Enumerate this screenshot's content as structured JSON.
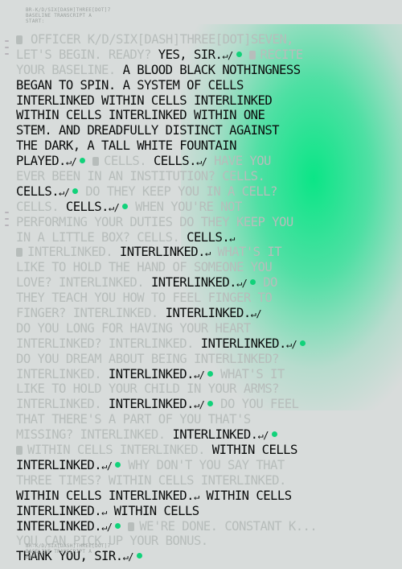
{
  "header_top": [
    "BR-K/D/SIX[DASH]THREE[DOT]7",
    "BASELINE TRANSCRIPT A",
    "START:"
  ],
  "header_bottom": [
    "BR-K/D/SIX[DASH]THREE[DOT]7",
    "BASELINE TRANSCRIPT A",
    "END:"
  ],
  "lines": [
    [
      [
        "sq",
        ""
      ],
      [
        "f",
        "OFFICER K/D/SIX[DASH]THREE[DOT]SEVEN,"
      ]
    ],
    [
      [
        "f",
        "LET'S BEGIN. READY? "
      ],
      [
        "d",
        "YES, SIR."
      ],
      [
        "m",
        "↵/"
      ],
      [
        "dot",
        ""
      ],
      [
        "f",
        " "
      ],
      [
        "sq",
        ""
      ],
      [
        "f",
        "RECITE"
      ]
    ],
    [
      [
        "f",
        "YOUR BASELINE. "
      ],
      [
        "d",
        "A BLOOD BLACK NOTHINGNESS"
      ]
    ],
    [
      [
        "d",
        "BEGAN TO SPIN. A SYSTEM OF CELLS"
      ]
    ],
    [
      [
        "d",
        "INTERLINKED WITHIN CELLS INTERLINKED"
      ]
    ],
    [
      [
        "d",
        "WITHIN CELLS INTERLINKED WITHIN ONE"
      ]
    ],
    [
      [
        "d",
        "STEM. AND DREADFULLY DISTINCT AGAINST"
      ]
    ],
    [
      [
        "d",
        "THE DARK, A TALL WHITE FOUNTAIN"
      ]
    ],
    [
      [
        "d",
        "PLAYED."
      ],
      [
        "m",
        "↵/"
      ],
      [
        "dot",
        ""
      ],
      [
        "f",
        " "
      ],
      [
        "sq",
        ""
      ],
      [
        "f",
        "CELLS. "
      ],
      [
        "d",
        "CELLS."
      ],
      [
        "m",
        "↵/"
      ],
      [
        "f",
        " HAVE YOU"
      ]
    ],
    [
      [
        "f",
        "EVER BEEN IN AN INSTITUTION? CELLS."
      ]
    ],
    [
      [
        "d",
        "CELLS."
      ],
      [
        "m",
        "↵/"
      ],
      [
        "dot",
        ""
      ],
      [
        "f",
        " DO THEY KEEP YOU IN A CELL?"
      ]
    ],
    [
      [
        "f",
        "CELLS. "
      ],
      [
        "d",
        "CELLS."
      ],
      [
        "m",
        "↵/"
      ],
      [
        "dot",
        ""
      ],
      [
        "f",
        " WHEN YOU'RE NOT"
      ]
    ],
    [
      [
        "f",
        "PERFORMING YOUR DUTIES DO THEY KEEP YOU"
      ]
    ],
    [
      [
        "f",
        "IN A LITTLE BOX? CELLS. "
      ],
      [
        "d",
        "CELLS."
      ],
      [
        "m",
        "↵"
      ]
    ],
    [
      [
        "sq",
        ""
      ],
      [
        "f",
        "INTERLINKED. "
      ],
      [
        "d",
        "INTERLINKED."
      ],
      [
        "m",
        "↵"
      ],
      [
        "f",
        "  WHAT'S IT"
      ]
    ],
    [
      [
        "f",
        "LIKE TO HOLD THE HAND OF SOMEONE YOU"
      ]
    ],
    [
      [
        "f",
        "LOVE? INTERLINKED. "
      ],
      [
        "d",
        "INTERLINKED."
      ],
      [
        "m",
        "↵/"
      ],
      [
        "dot",
        ""
      ],
      [
        "f",
        " DO"
      ]
    ],
    [
      [
        "f",
        "THEY TEACH YOU HOW TO FEEL FINGER TO"
      ]
    ],
    [
      [
        "f",
        "FINGER? INTERLINKED. "
      ],
      [
        "d",
        "INTERLINKED."
      ],
      [
        "m",
        "↵/"
      ]
    ],
    [
      [
        "f",
        "DO YOU LONG FOR HAVING YOUR HEART"
      ]
    ],
    [
      [
        "f",
        "INTERLINKED? INTERLINKED. "
      ],
      [
        "d",
        "INTERLINKED."
      ],
      [
        "m",
        "↵/"
      ],
      [
        "dot",
        ""
      ]
    ],
    [
      [
        "f",
        "DO YOU DREAM ABOUT BEING INTERLINKED?"
      ]
    ],
    [
      [
        "f",
        "INTERLINKED. "
      ],
      [
        "d",
        "INTERLINKED."
      ],
      [
        "m",
        "↵/"
      ],
      [
        "dot",
        ""
      ],
      [
        "f",
        " WHAT'S IT"
      ]
    ],
    [
      [
        "f",
        "LIKE TO HOLD YOUR CHILD IN YOUR ARMS?"
      ]
    ],
    [
      [
        "f",
        "INTERLINKED. "
      ],
      [
        "d",
        "INTERLINKED."
      ],
      [
        "m",
        "↵/"
      ],
      [
        "dot",
        ""
      ],
      [
        "f",
        " DO YOU FEEL"
      ]
    ],
    [
      [
        "f",
        "THAT THERE'S A PART OF YOU THAT'S"
      ]
    ],
    [
      [
        "f",
        "MISSING? INTERLINKED. "
      ],
      [
        "d",
        "INTERLINKED."
      ],
      [
        "m",
        "↵/"
      ],
      [
        "dot",
        ""
      ]
    ],
    [
      [
        "sq",
        ""
      ],
      [
        "f",
        "WITHIN CELLS INTERLINKED. "
      ],
      [
        "d",
        "WITHIN CELLS"
      ]
    ],
    [
      [
        "d",
        "INTERLINKED."
      ],
      [
        "m",
        "↵/"
      ],
      [
        "dot",
        ""
      ],
      [
        "f",
        " WHY DON'T YOU SAY THAT"
      ]
    ],
    [
      [
        "f",
        "THREE TIMES? WITHIN CELLS INTERLINKED."
      ]
    ],
    [
      [
        "d",
        "WITHIN CELLS INTERLINKED."
      ],
      [
        "m",
        "↵"
      ],
      [
        "d",
        " WITHIN CELLS"
      ]
    ],
    [
      [
        "d",
        "INTERLINKED."
      ],
      [
        "m",
        "↵"
      ],
      [
        "d",
        " WITHIN CELLS"
      ]
    ],
    [
      [
        "d",
        "INTERLINKED."
      ],
      [
        "m",
        "↵/"
      ],
      [
        "dot",
        ""
      ],
      [
        "f",
        " "
      ],
      [
        "sq",
        ""
      ],
      [
        "f",
        "WE'RE DONE. CONSTANT K..."
      ]
    ],
    [
      [
        "f",
        "YOU CAN PICK UP YOUR BONUS."
      ]
    ],
    [
      [
        "d",
        "THANK YOU, SIR."
      ],
      [
        "m",
        "↵/"
      ],
      [
        "dot",
        ""
      ]
    ]
  ]
}
